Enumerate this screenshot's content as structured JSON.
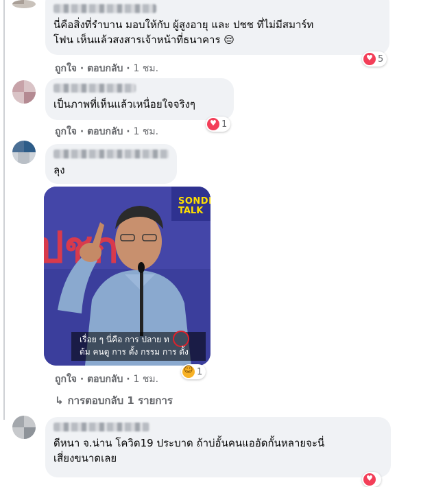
{
  "comments": [
    {
      "text": "นี่คือสิ่งที่รำบาน มอบให้กับ ผู้สูงอายุ และ ปชช ที่ไม่มีสมาร์ท\nโฟน เห็นแล้วสงสารเจ้าหน้าที่ธนาคาร 😔",
      "actions": {
        "like": "ถูกใจ",
        "reply": "ตอบกลับ",
        "time": "1 ชม."
      },
      "reaction": {
        "type": "love",
        "count": "5"
      }
    },
    {
      "text": "เป็นภาพที่เห็นแล้วเหนื่อยใจจริงๆ",
      "actions": {
        "like": "ถูกใจ",
        "reply": "ตอบกลับ",
        "time": "1 ชม."
      },
      "reaction": {
        "type": "love",
        "count": "1"
      }
    },
    {
      "text": "ลุง",
      "photo": {
        "watermark_line1": "SONDH",
        "watermark_line2": "TALK",
        "caption_line1": "เรื่อย ๆ นี่คือ การ ปลาย ท",
        "caption_line2": "ต้ม คนดู การ ตั้ง กรรม การ ตั้ง"
      },
      "actions": {
        "like": "ถูกใจ",
        "reply": "ตอบกลับ",
        "time": "1 ชม."
      },
      "reaction": {
        "type": "haha",
        "count": "1"
      },
      "replies_link": "การตอบกลับ 1 รายการ"
    },
    {
      "text": "ดีหนา จ.น่าน โควิด19 ประบาด ถ้าบ่อั้นคนแออัดกั้นหลายจะนี่\nเสี่ยงขนาดเลย"
    }
  ],
  "colors": {
    "bubble": "#f0f2f5",
    "meta": "#65676b",
    "love": "#f33e58",
    "haha": "#f7b125"
  }
}
